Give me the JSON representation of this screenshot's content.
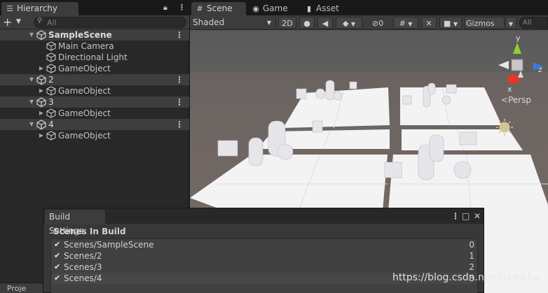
{
  "hierarchy": {
    "tab_label": "Hierarchy",
    "search_placeholder": "All",
    "rows": [
      {
        "label": "SampleScene",
        "kind": "scene",
        "bold": true
      },
      {
        "label": "Main Camera",
        "kind": "child",
        "expandable": false
      },
      {
        "label": "Directional Light",
        "kind": "child",
        "expandable": false
      },
      {
        "label": "GameObject",
        "kind": "child",
        "expandable": true
      },
      {
        "label": "2",
        "kind": "scene",
        "bold": false
      },
      {
        "label": "GameObject",
        "kind": "child",
        "expandable": true
      },
      {
        "label": "3",
        "kind": "scene",
        "bold": false
      },
      {
        "label": "GameObject",
        "kind": "child",
        "expandable": true
      },
      {
        "label": "4",
        "kind": "scene",
        "bold": false
      },
      {
        "label": "GameObject",
        "kind": "child",
        "expandable": true
      }
    ]
  },
  "project_tab": "Proje",
  "scene_tabs": {
    "scene": "Scene",
    "game": "Game",
    "asset_store": "Asset Store"
  },
  "scene_toolbar": {
    "draw_mode": "Shaded",
    "mode_2d": "2D",
    "effects_count": "0",
    "gizmos": "Gizmos",
    "search_placeholder": "All"
  },
  "gizmo": {
    "y": "y",
    "x": "x",
    "z": "z",
    "persp": "Persp"
  },
  "build_settings": {
    "title": "Build Settings",
    "section": "Scenes In Build",
    "scenes": [
      {
        "name": "Scenes/SampleScene",
        "index": "0",
        "checked": true
      },
      {
        "name": "Scenes/2",
        "index": "1",
        "checked": true
      },
      {
        "name": "Scenes/3",
        "index": "2",
        "checked": true
      },
      {
        "name": "Scenes/4",
        "index": "3",
        "checked": true
      }
    ]
  },
  "watermark": "https://blog.csdn.net/lhswwha",
  "colors": {
    "panel": "#282828",
    "scene_row": "#3e3e3e",
    "toolbar": "#3c3c3c",
    "gizmo_y": "#8ccf3a",
    "gizmo_x": "#e0392b",
    "gizmo_z": "#3a7bd5"
  }
}
